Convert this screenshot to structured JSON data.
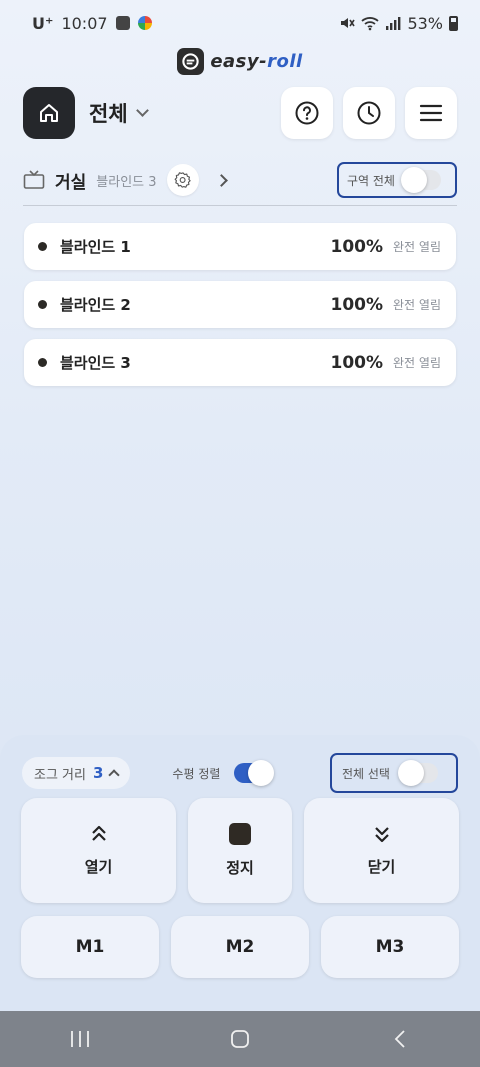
{
  "status_bar": {
    "carrier": "U⁺",
    "time": "10:07",
    "battery": "53%"
  },
  "logo": {
    "part1": "easy-",
    "part2": "roll"
  },
  "header": {
    "title": "전체"
  },
  "room": {
    "name": "거실",
    "blind_count_label": "블라인드 3",
    "zone_toggle_label": "구역 전체",
    "zone_toggle_on": false
  },
  "blinds": [
    {
      "name": "블라인드 1",
      "percent": "100%",
      "status": "완전 열림"
    },
    {
      "name": "블라인드 2",
      "percent": "100%",
      "status": "완전 열림"
    },
    {
      "name": "블라인드 3",
      "percent": "100%",
      "status": "완전 열림"
    }
  ],
  "controls": {
    "jog_label": "조그 거리",
    "jog_value": "3",
    "align_label": "수평 정렬",
    "align_on": true,
    "select_all_label": "전체 선택",
    "select_all_on": false,
    "open_label": "열기",
    "stop_label": "정지",
    "close_label": "닫기",
    "m1": "M1",
    "m2": "M2",
    "m3": "M3"
  },
  "colors": {
    "accent": "#2f5fc4",
    "highlight_border": "#24479b",
    "home_button": "#25272b"
  }
}
